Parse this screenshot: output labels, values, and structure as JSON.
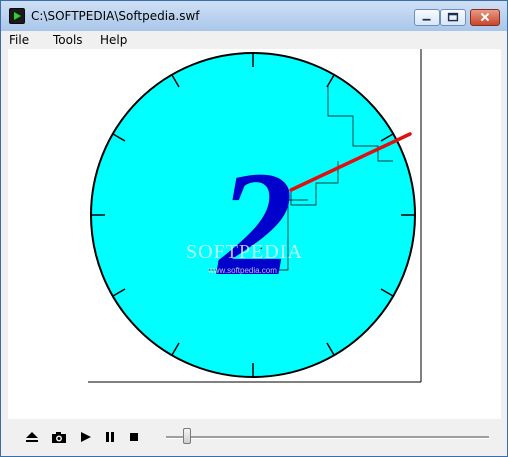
{
  "window": {
    "title": "C:\\SOFTPEDIA\\Softpedia.swf"
  },
  "menu": {
    "file": "File",
    "tools": "Tools",
    "help": "Help"
  },
  "movie": {
    "digit": "2",
    "watermark": "SOFTPEDIA",
    "watermark_small": "www.softpedia.com",
    "colors": {
      "dial_fill": "#00ffff",
      "dial_stroke": "#000000",
      "hand": "#e01010",
      "digit": "#0000cc"
    }
  },
  "controls": {
    "icons": [
      "eject-icon",
      "camera-icon",
      "play-icon",
      "pause-icon",
      "stop-icon"
    ]
  }
}
